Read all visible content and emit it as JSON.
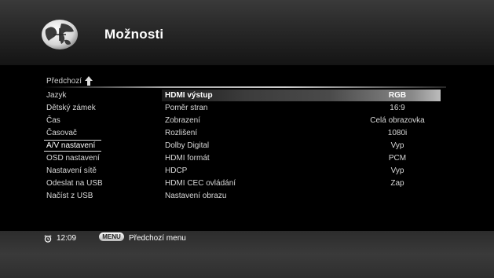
{
  "header": {
    "title": "Možnosti"
  },
  "nav": {
    "previous": "Předchozí"
  },
  "menu": {
    "items": [
      {
        "label": "Jazyk"
      },
      {
        "label": "Dětský zámek"
      },
      {
        "label": "Čas"
      },
      {
        "label": "Časovač"
      },
      {
        "label": "A/V nastavení"
      },
      {
        "label": "OSD nastavení"
      },
      {
        "label": "Nastavení sítě"
      },
      {
        "label": "Odeslat na USB"
      },
      {
        "label": "Načíst z USB"
      }
    ],
    "selected": "A/V nastavení"
  },
  "settings": {
    "rows": [
      {
        "label": "HDMI výstup",
        "value": "RGB"
      },
      {
        "label": "Poměr stran",
        "value": "16:9"
      },
      {
        "label": "Zobrazení",
        "value": "Celá obrazovka"
      },
      {
        "label": "Rozlišení",
        "value": "1080i"
      },
      {
        "label": "Dolby Digital",
        "value": "Vyp"
      },
      {
        "label": "HDMI formát",
        "value": "PCM"
      },
      {
        "label": "HDCP",
        "value": "Vyp"
      },
      {
        "label": "HDMI CEC ovládání",
        "value": "Zap"
      },
      {
        "label": "Nastavení obrazu",
        "value": ""
      }
    ],
    "highlighted": "HDMI výstup"
  },
  "footer": {
    "time": "12:09",
    "menu_key": "MENU",
    "menu_hint": "Předchozí menu"
  },
  "icons": {
    "logo": "globe-logo-icon",
    "previous": "arrow-up-icon",
    "clock": "alarm-clock-icon"
  }
}
